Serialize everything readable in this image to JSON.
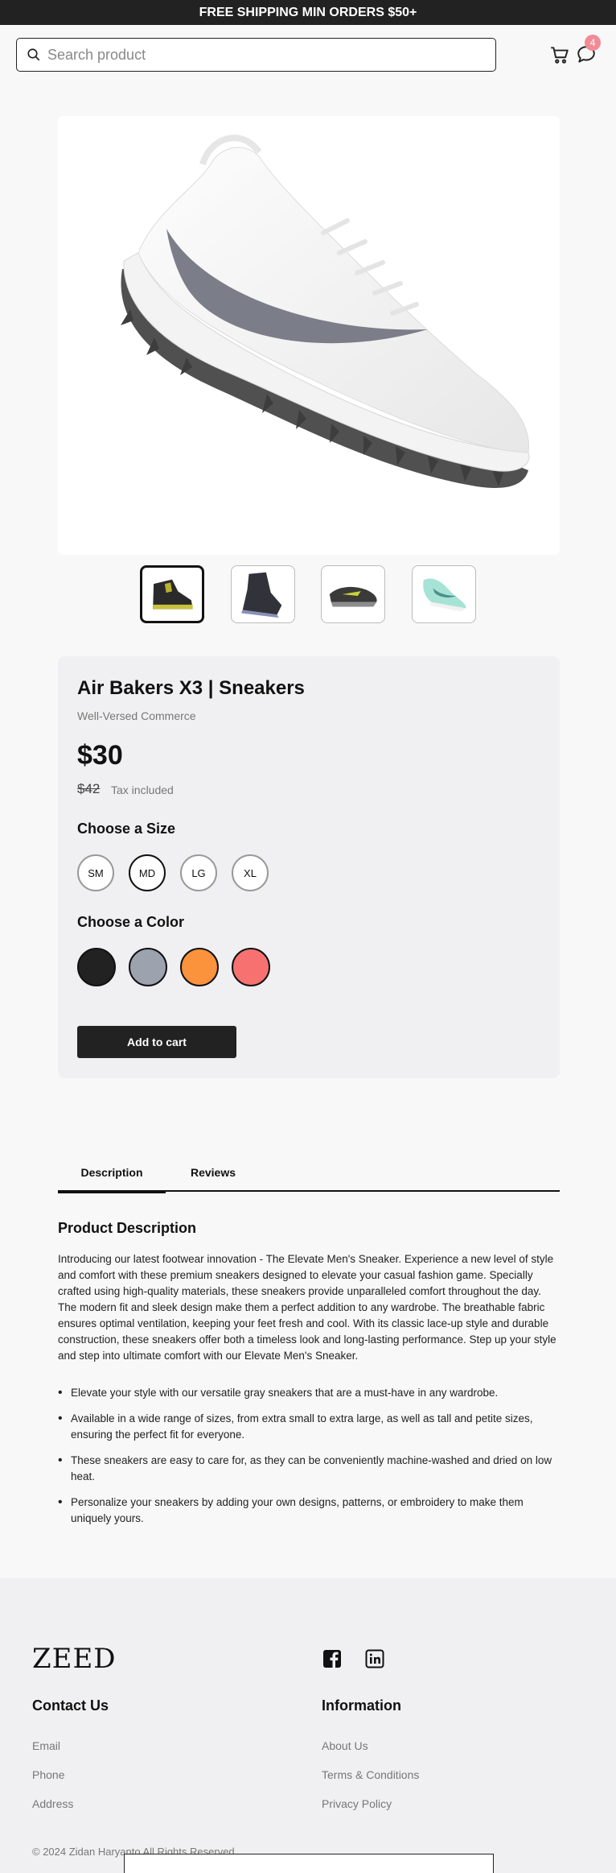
{
  "announcement": "FREE SHIPPING MIN ORDERS $50+",
  "header": {
    "search_placeholder": "Search product",
    "cart_icon": "cart-icon",
    "chat_icon": "chat-icon",
    "chat_badge": "4"
  },
  "gallery": {
    "thumbnails": [
      "dark-boot-yellow-accents",
      "black-high-top-sneaker",
      "black-running-shoe",
      "mint-green-sneaker"
    ],
    "selected_index": 0
  },
  "product": {
    "title": "Air Bakers X3 | Sneakers",
    "vendor": "Well-Versed Commerce",
    "price": "$30",
    "compare_price": "$42",
    "tax_note": "Tax included",
    "size_label": "Choose a Size",
    "sizes": [
      "SM",
      "MD",
      "LG",
      "XL"
    ],
    "selected_size": "MD",
    "color_label": "Choose a Color",
    "colors": [
      "#222222",
      "#9ca3af",
      "#fb923c",
      "#f87171"
    ],
    "add_to_cart": "Add to cart"
  },
  "tabs": [
    "Description",
    "Reviews"
  ],
  "description": {
    "title": "Product Description",
    "body": "Introducing our latest footwear innovation - The Elevate Men's Sneaker. Experience a new level of style and comfort with these premium sneakers designed to elevate your casual fashion game. Specially crafted using high-quality materials, these sneakers provide unparalleled comfort throughout the day. The modern fit and sleek design make them a perfect addition to any wardrobe. The breathable fabric ensures optimal ventilation, keeping your feet fresh and cool. With its classic lace-up style and durable construction, these sneakers offer both a timeless look and long-lasting performance. Step up your style and step into ultimate comfort with our Elevate Men's Sneaker.",
    "bullets": [
      "Elevate your style with our versatile gray sneakers that are a must-have in any wardrobe.",
      "Available in a wide range of sizes, from extra small to extra large, as well as tall and petite sizes, ensuring the perfect fit for everyone.",
      "These sneakers are easy to care for, as they can be conveniently machine-washed and dried on low heat.",
      "Personalize your sneakers by adding your own designs, patterns, or embroidery to make them uniquely yours."
    ]
  },
  "footer": {
    "logo": "ZEED",
    "contact_heading": "Contact Us",
    "contact_links": [
      "Email",
      "Phone",
      "Address"
    ],
    "info_heading": "Information",
    "info_links": [
      "About Us",
      "Terms & Conditions",
      "Privacy Policy"
    ],
    "social_icons": [
      "facebook-icon",
      "linkedin-icon"
    ],
    "copyright": "© 2024 Zidan Haryanto All Rights Reserved"
  }
}
